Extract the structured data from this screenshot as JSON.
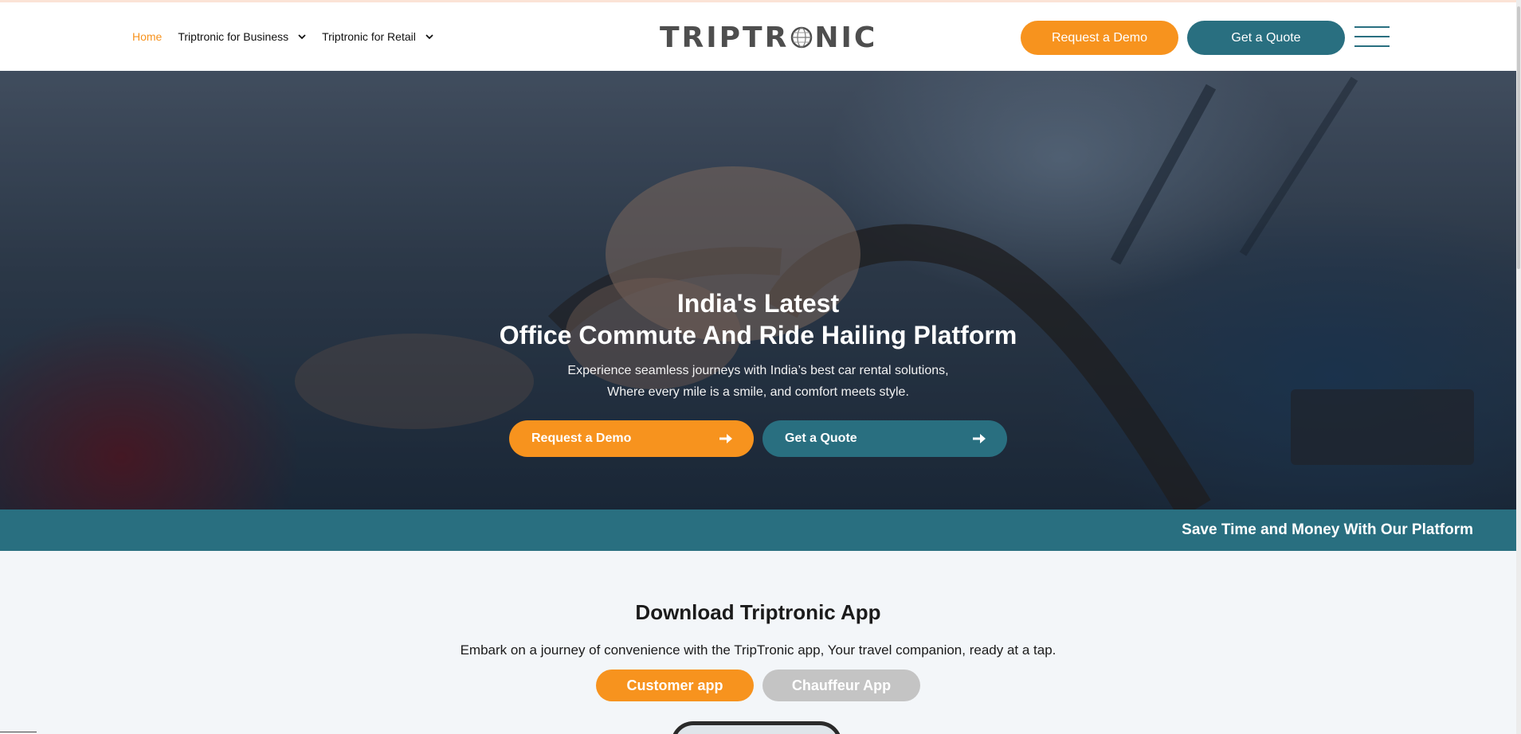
{
  "header": {
    "nav": [
      {
        "label": "Home",
        "active": true,
        "has_dropdown": false
      },
      {
        "label": "Triptronic for Business",
        "active": false,
        "has_dropdown": true
      },
      {
        "label": "Triptronic for Retail",
        "active": false,
        "has_dropdown": true
      }
    ],
    "logo": {
      "left": "TRIPTR",
      "right": "NIC",
      "icon": "globe-icon"
    },
    "request_demo_label": "Request a Demo",
    "get_quote_label": "Get a Quote",
    "menu_icon": "hamburger-menu-icon"
  },
  "hero": {
    "title_line1": "India's Latest",
    "title_line2": "Office Commute And Ride Hailing Platform",
    "subtitle_line1": "Experience seamless journeys with India’s best car rental solutions,",
    "subtitle_line2": "Where every mile is a smile, and comfort meets style.",
    "request_demo_label": "Request a Demo",
    "get_quote_label": "Get a Quote",
    "arrow_icon": "arrow-right-icon"
  },
  "ticker": {
    "text": "Save Time and Money With Our Platform"
  },
  "download": {
    "title": "Download Triptronic App",
    "description": "Embark on a journey of convenience with the TripTronic app, Your travel companion, ready at a tap.",
    "customer_app_label": "Customer app",
    "chauffeur_app_label": "Chauffeur App"
  },
  "colors": {
    "accent_orange": "#f7931e",
    "accent_teal": "#296f80",
    "inactive_gray": "#c4c4c4",
    "logo_gray": "#4e4e4e"
  }
}
